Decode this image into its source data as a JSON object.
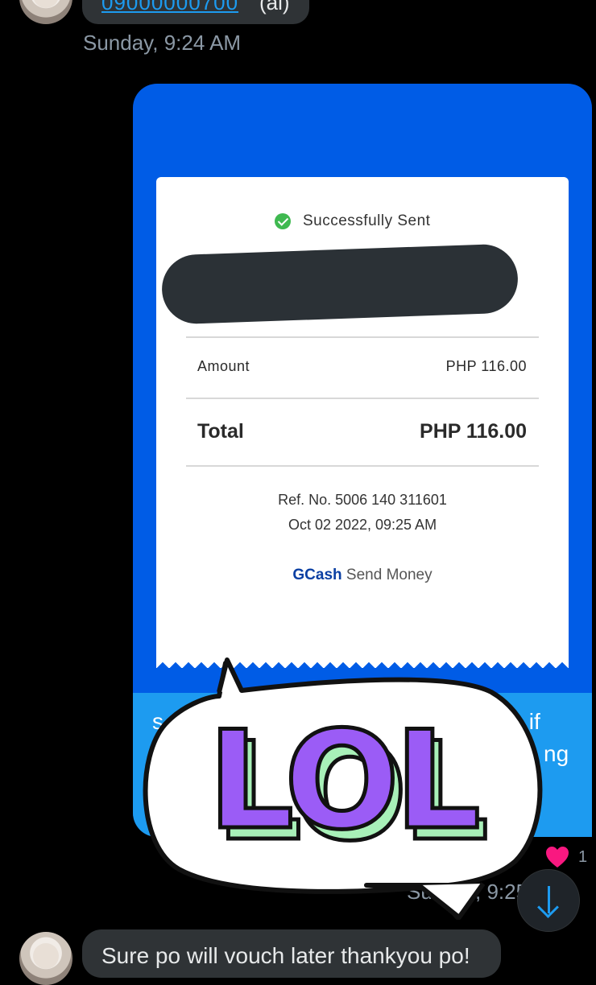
{
  "top_message": {
    "link_text": "09000000700",
    "tail_text": "(al)",
    "timestamp": "Sunday, 9:24 AM"
  },
  "receipt": {
    "status": "Successfully Sent",
    "amount_label": "Amount",
    "amount_value": "PHP 116.00",
    "total_label": "Total",
    "total_value": "PHP 116.00",
    "ref_no": "Ref. No. 5006 140 311601",
    "date": "Oct 02 2022, 09:25 AM",
    "brand": "GCash",
    "service": "Send Money"
  },
  "card_text": {
    "line1_left": "s",
    "line1_right": "s if",
    "line2_right": "ng"
  },
  "reaction": {
    "icon": "heart-icon",
    "count": "1"
  },
  "sent_timestamp": {
    "left": "Sun",
    "right": ", 9:25"
  },
  "sticker_text": "LOL",
  "bottom_message": {
    "text": "Sure po will vouch later thankyou po!"
  },
  "colors": {
    "background": "#000000",
    "card_blue": "#005ce6",
    "card_light_blue": "#1d9bf0",
    "sticker_purple": "#9b5cf6",
    "sticker_green": "#a8f0b8"
  }
}
